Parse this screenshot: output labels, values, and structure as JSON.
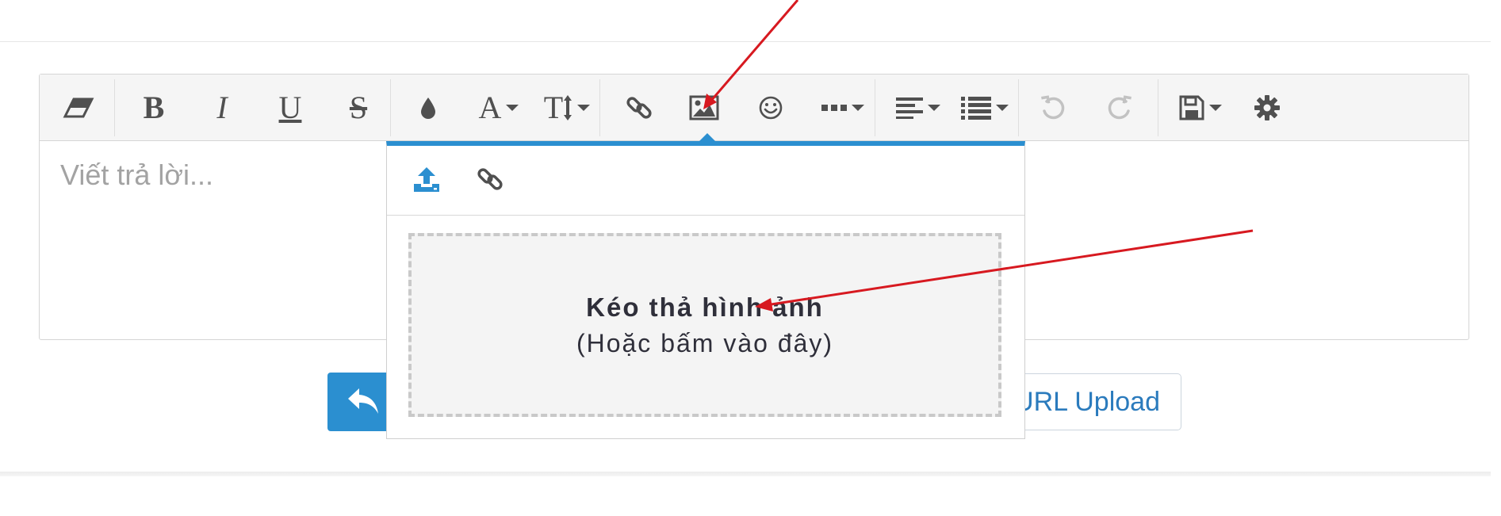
{
  "editor": {
    "placeholder": "Viết trả lời...",
    "toolbar": {
      "bold": "B",
      "italic": "I",
      "underline": "U",
      "strike": "S",
      "font": "A",
      "size": "T"
    }
  },
  "popup": {
    "dropzone_title": "Kéo thả hình ảnh",
    "dropzone_subtitle": "(Hoặc bấm vào đây)"
  },
  "buttons": {
    "url_upload": "URL Upload"
  },
  "colors": {
    "accent": "#2b8fd0",
    "annotation": "#d71920",
    "toolbar_bg": "#f5f5f5"
  }
}
